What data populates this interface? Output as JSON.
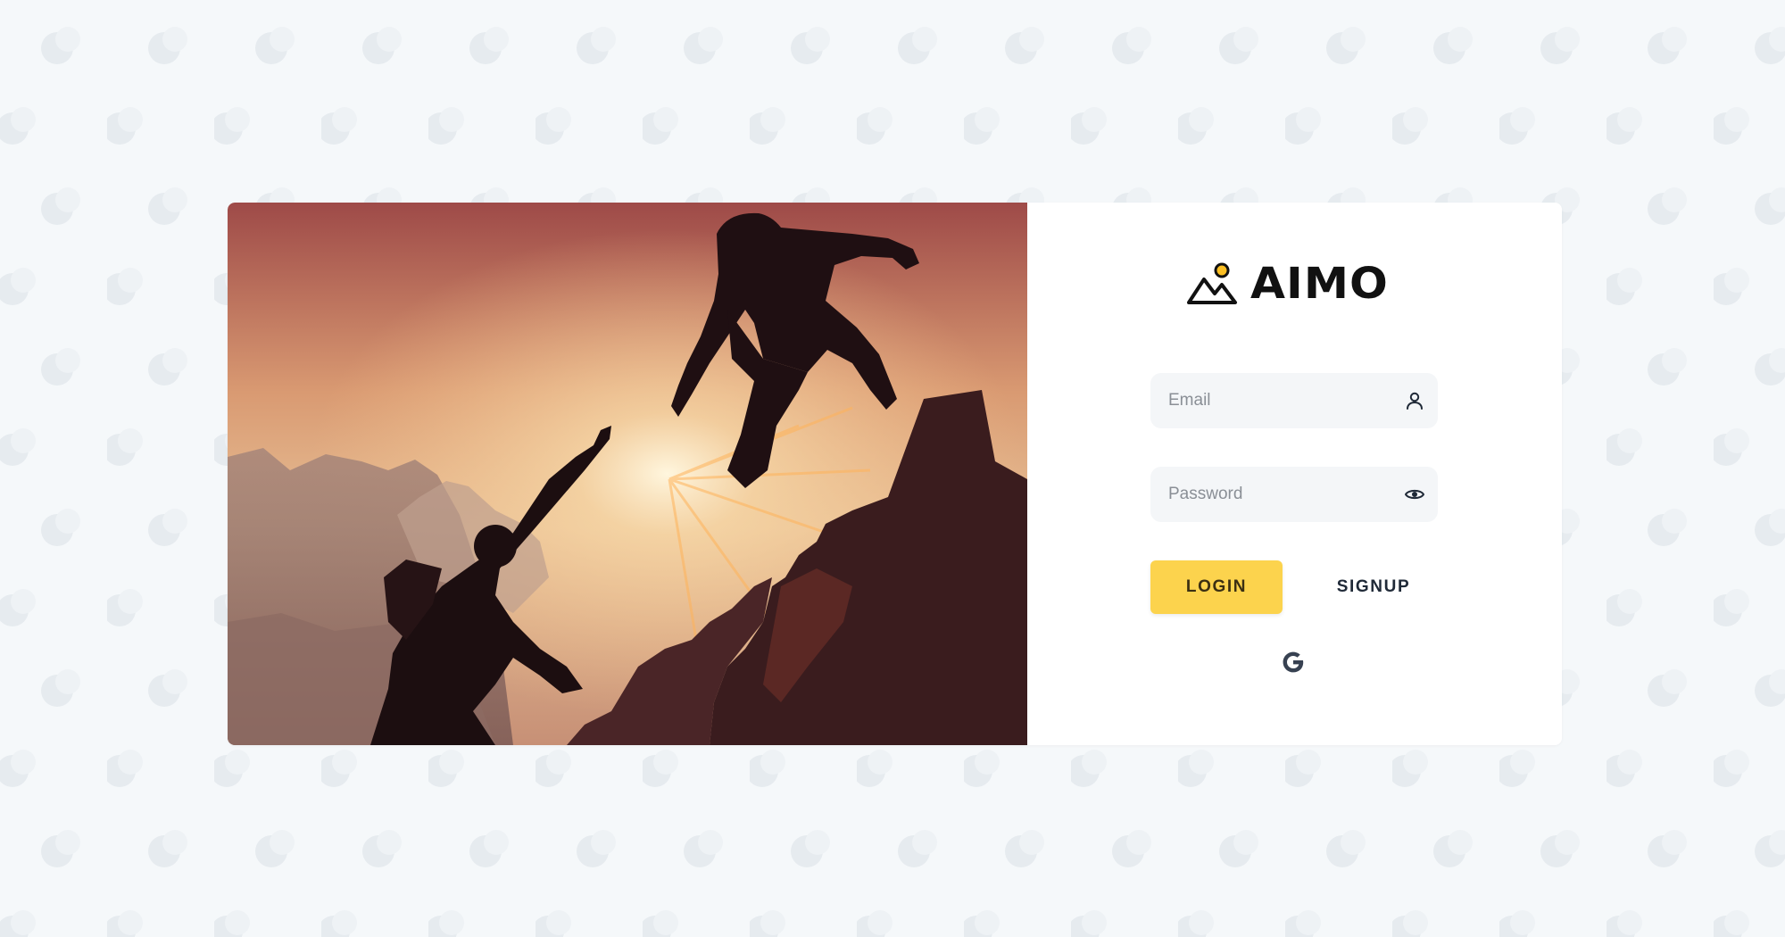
{
  "app": {
    "logo_text": "AIMO",
    "logo_icon": "mountain-sun-icon"
  },
  "hero": {
    "image": "climbers-helping-hand-sunset-photo"
  },
  "form": {
    "email": {
      "placeholder": "Email",
      "icon": "user-icon"
    },
    "password": {
      "placeholder": "Password",
      "icon": "eye-icon"
    },
    "login_label": "LOGIN",
    "signup_label": "SIGNUP",
    "social_icon": "google-icon"
  },
  "colors": {
    "background": "#f5f8fa",
    "accent": "#fcd34d",
    "panel": "#ffffff",
    "text_dark": "#1f2937"
  }
}
